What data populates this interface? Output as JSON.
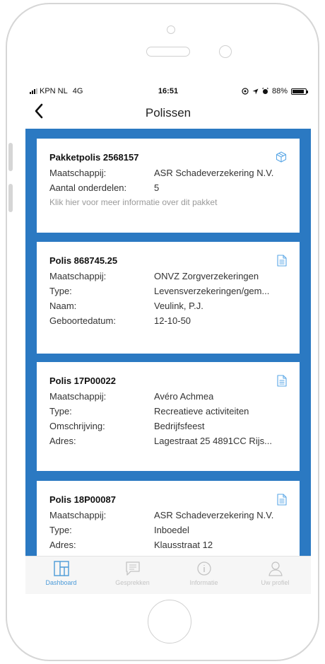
{
  "statusbar": {
    "carrier": "KPN NL",
    "network": "4G",
    "time": "16:51",
    "battery": "88%",
    "battery_level": 0.88
  },
  "navbar": {
    "title": "Polissen"
  },
  "cards": [
    {
      "title": "Pakketpolis 2568157",
      "icon": "package-icon",
      "rows": [
        {
          "label": "Maatschappij:",
          "value": "ASR Schadeverzekering N.V."
        },
        {
          "label": "Aantal onderdelen:",
          "value": "5"
        }
      ],
      "hint": "Klik hier voor meer informatie over dit pakket"
    },
    {
      "title": "Polis 868745.25",
      "icon": "document-icon",
      "rows": [
        {
          "label": "Maatschappij:",
          "value": "ONVZ Zorgverzekeringen"
        },
        {
          "label": "Type:",
          "value": "Levensverzekeringen/gem..."
        },
        {
          "label": "Naam:",
          "value": "Veulink, P.J."
        },
        {
          "label": "Geboortedatum:",
          "value": "12-10-50"
        }
      ]
    },
    {
      "title": "Polis 17P00022",
      "icon": "document-icon",
      "rows": [
        {
          "label": "Maatschappij:",
          "value": "Avéro Achmea"
        },
        {
          "label": "Type:",
          "value": "Recreatieve activiteiten"
        },
        {
          "label": "Omschrijving:",
          "value": "Bedrijfsfeest"
        },
        {
          "label": "Adres:",
          "value": "Lagestraat  25 4891CC Rijs..."
        }
      ]
    },
    {
      "title": "Polis 18P00087",
      "icon": "document-icon",
      "rows": [
        {
          "label": "Maatschappij:",
          "value": "ASR Schadeverzekering N.V."
        },
        {
          "label": "Type:",
          "value": "Inboedel"
        },
        {
          "label": "Adres:",
          "value": "Klausstraat 12"
        }
      ]
    }
  ],
  "tabs": [
    {
      "label": "Dashboard",
      "icon": "dashboard-icon",
      "active": true
    },
    {
      "label": "Gesprekken",
      "icon": "chat-icon",
      "active": false
    },
    {
      "label": "Informatie",
      "icon": "info-icon",
      "active": false
    },
    {
      "label": "Uw profiel",
      "icon": "profile-icon",
      "active": false
    }
  ],
  "colors": {
    "accent": "#2b79c2",
    "tab_active": "#4a9ad8",
    "tab_inactive": "#c4c4c4",
    "icon_blue": "#5aa7e6"
  }
}
